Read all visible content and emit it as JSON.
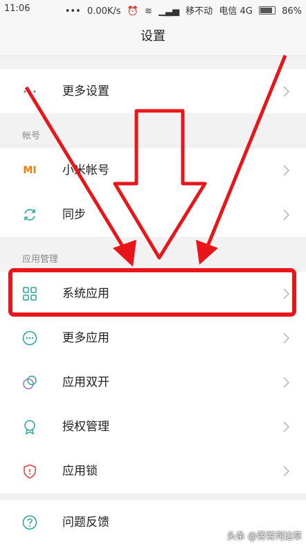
{
  "status_bar": {
    "time": "11:06",
    "speed": "0.00K/s",
    "carrier1": "移不动",
    "carrier2": "电信 4G",
    "battery": "86%"
  },
  "header": {
    "title": "设置"
  },
  "sections": {
    "account_label": "帐号",
    "app_management_label": "应用管理"
  },
  "items": {
    "more_settings": "更多设置",
    "mi_account": "小米帐号",
    "mi_account_icon_text": "MI",
    "sync": "同步",
    "system_apps": "系统应用",
    "more_apps": "更多应用",
    "dual_apps": "应用双开",
    "permissions": "授权管理",
    "app_lock": "应用锁",
    "feedback": "问题反馈"
  },
  "icons": {
    "more_settings": "more-dots-icon",
    "mi_account": "mi-logo-icon",
    "sync": "sync-icon",
    "system_apps": "grid-icon",
    "more_apps": "dots-circle-icon",
    "dual_apps": "dual-circle-icon",
    "permissions": "badge-icon",
    "app_lock": "shield-icon",
    "feedback": "question-icon"
  },
  "colors": {
    "accent_teal": "#26a69a",
    "mi_orange": "#f57c00",
    "purple": "#9575cd",
    "shield_red": "#e53935",
    "annotation_red": "#e8151b"
  },
  "watermark": "头条 @菁菁河边草"
}
